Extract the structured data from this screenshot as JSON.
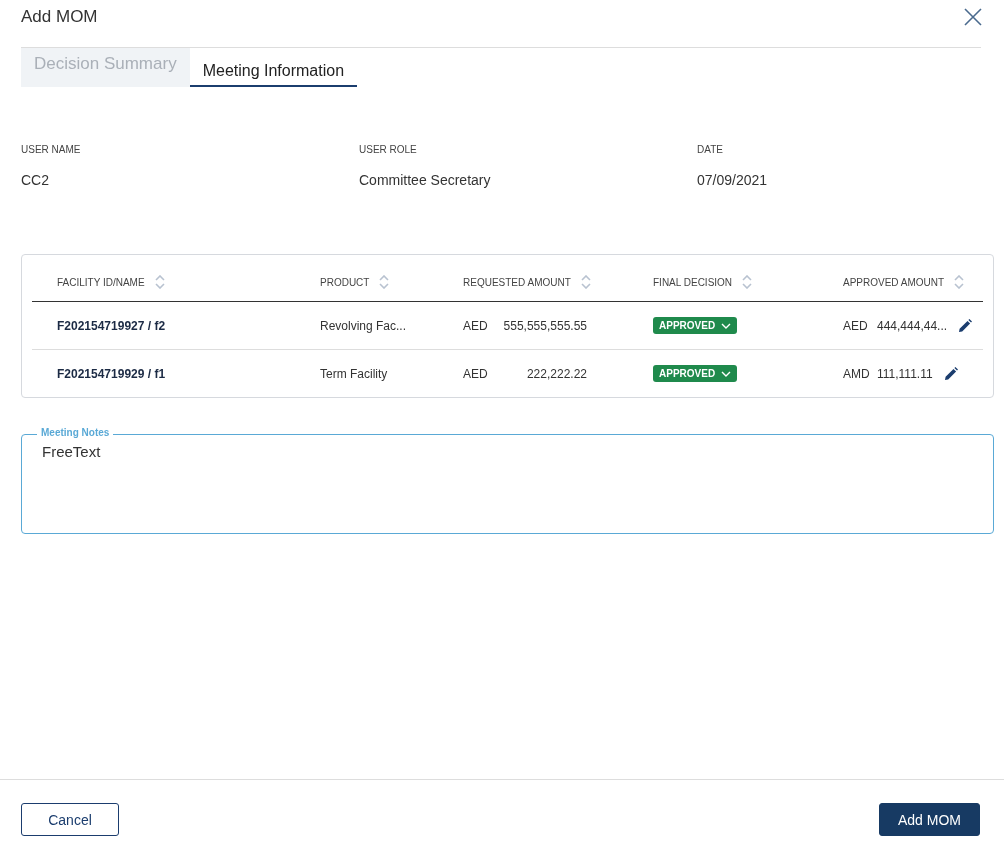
{
  "dialog": {
    "title": "Add MOM"
  },
  "tabs": [
    {
      "label": "Decision Summary",
      "selected": false
    },
    {
      "label": "Meeting Information",
      "selected": true
    }
  ],
  "info": [
    {
      "label": "USER NAME",
      "value": "CC2"
    },
    {
      "label": "USER ROLE",
      "value": "Committee Secretary"
    },
    {
      "label": "DATE",
      "value": "07/09/2021"
    }
  ],
  "table": {
    "columns": [
      "FACILITY ID/NAME",
      "PRODUCT",
      "REQUESTED AMOUNT",
      "FINAL DECISION",
      "APPROVED AMOUNT"
    ],
    "rows": [
      {
        "facility": "F202154719927 / f2",
        "product": "Revolving Fac...",
        "requested_currency": "AED",
        "requested_amount": "555,555,555.55",
        "decision": "APPROVED",
        "approved_currency": "AED",
        "approved_amount": "444,444,44..."
      },
      {
        "facility": "F202154719929 / f1",
        "product": "Term Facility",
        "requested_currency": "AED",
        "requested_amount": "222,222.22",
        "decision": "APPROVED",
        "approved_currency": "AMD",
        "approved_amount": "111,111.11"
      }
    ]
  },
  "notes": {
    "label": "Meeting Notes",
    "value": "FreeText"
  },
  "buttons": [
    {
      "label": "Cancel",
      "kind": "secondary"
    },
    {
      "label": "Add MOM",
      "kind": "primary"
    }
  ]
}
